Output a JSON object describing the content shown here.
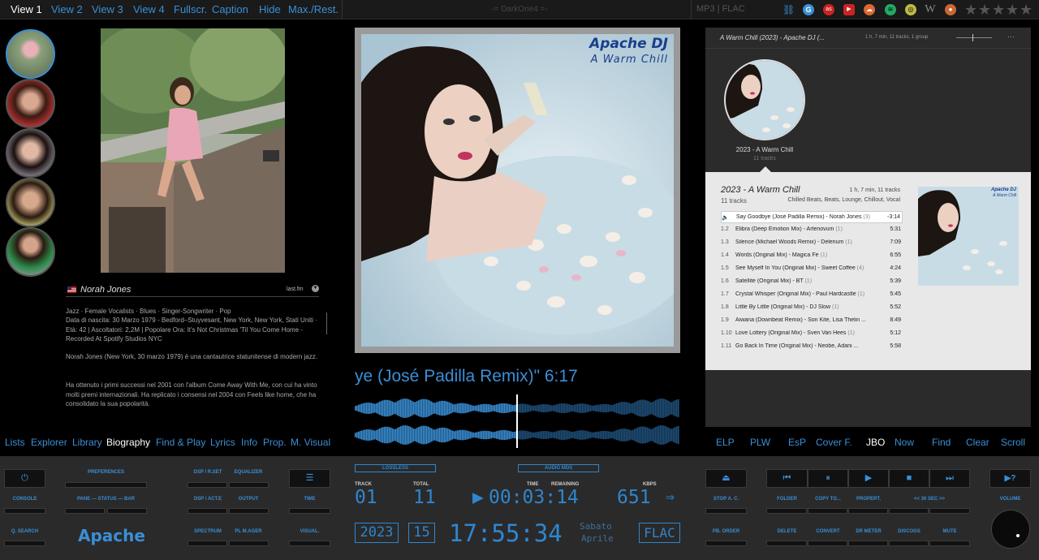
{
  "top_tabs": [
    "View 1",
    "View 2",
    "View 3",
    "View 4",
    "Fullscr.",
    "Caption",
    "Hide",
    "Max./Rest."
  ],
  "app_title": "-= DarkOne4 =-",
  "format_label": "MP3 | FLAC",
  "colors": {
    "accent": "#3a8fd6",
    "lcd": "#2f86cf",
    "list_bg": "#e8e8e8"
  },
  "web_icons": [
    "link-icon",
    "google-icon",
    "lastfm-icon",
    "youtube-icon",
    "soundcloud-icon",
    "spotify-icon",
    "discogs-icon",
    "wikipedia-icon",
    "musicbrainz-icon"
  ],
  "rating": {
    "stars": 5,
    "value": 0
  },
  "artist": {
    "name": "Norah Jones",
    "source": "last.fm",
    "tags": "Jazz · Female Vocalists · Blues · Singer-Songwriter · Pop",
    "info": "Data di nascita: 30 Marzo 1979 - Bedford–Stuyvesant, New York, New York, Stati Uniti · Età: 42  |  Ascoltatori: 2,2M  |  Popolare Ora: It's Not Christmas 'Til You Come Home - Recorded At Spotify Studios NYC",
    "bio1": "Norah Jones (New York, 30 marzo 1979) è una cantautrice statunitense di modern jazz.",
    "bio2": "Ha ottenuto i primi successi nel 2001 con l'album Come Away With Me, con cui ha vinto molti premi internazionali. Ha replicato i consensi nel 2004 con Feels like home, che ha consolidato la sua popolarità."
  },
  "cover": {
    "line1": "Apache DJ",
    "line2": "A Warm Chill"
  },
  "now_playing_scroll": "ye (José Padilla Remix)\" 6:17",
  "progress": 0.5,
  "album_panel": {
    "header_title": "A Warm Chill (2023) - Apache DJ (...",
    "header_meta": "1 h, 7 min,   11 tracks,   1 group",
    "year_album": "2023 - A Warm Chill",
    "tracks_short": "11 tracks",
    "album_title": "2023 - A Warm Chill",
    "duration": "1 h, 7 min,  11 tracks",
    "track_count": "11 tracks",
    "genres": "Chilled Beats, Beats, Lounge, Chillout, Vocal",
    "art_line1": "Apache DJ",
    "art_line2": "A Warm Chill"
  },
  "tracks": [
    {
      "num": "🔈",
      "title": "Say Goodbye (José Padilla Remix) - Norah Jones",
      "count": "(3)",
      "dur": "-3:14",
      "playing": true
    },
    {
      "num": "1.2",
      "title": "Elibra (Deep Emotion Mix) - Artenovum",
      "count": "(1)",
      "dur": "5:31"
    },
    {
      "num": "1.3",
      "title": "Silence (Michael Woods Remix) - Delerium",
      "count": "(1)",
      "dur": "7:09"
    },
    {
      "num": "1.4",
      "title": "Words (Original Mix) - Magica Fe",
      "count": "(1)",
      "dur": "6:55"
    },
    {
      "num": "1.5",
      "title": "See Myself In You (Original Mix) - Sweet Coffee",
      "count": "(4)",
      "dur": "4:24"
    },
    {
      "num": "1.6",
      "title": "Satellite (Original Mix) - BT",
      "count": "(1)",
      "dur": "5:39"
    },
    {
      "num": "1.7",
      "title": "Crystal Whisper (Original Mix) - Paul Hardcastle",
      "count": "(1)",
      "dur": "5:45"
    },
    {
      "num": "1.8",
      "title": "Little By Little (Original Mix) - DJ Slow",
      "count": "(1)",
      "dur": "5:52"
    },
    {
      "num": "1.9",
      "title": "Aiwana (Downbeat Remix) - Son Kite, Lisa Thelin ...",
      "count": "",
      "dur": "8:49"
    },
    {
      "num": "1.10",
      "title": "Love Lottery (Original Mix) - Sven Van Hees",
      "count": "(1)",
      "dur": "5:12"
    },
    {
      "num": "1.11",
      "title": "Go Back In Time (Original Mix) - Neobe, Adani ...",
      "count": "",
      "dur": "5:58"
    }
  ],
  "left_nav": [
    "Lists",
    "Explorer",
    "Library",
    "Biography",
    "Find & Play",
    "Lyrics",
    "Info",
    "Prop.",
    "M. Visual"
  ],
  "left_nav_active": "Biography",
  "right_nav": [
    "ELP",
    "PLW",
    "EsP",
    "Cover F.",
    "JBO",
    "Now",
    "Find",
    "Clear",
    "Scroll"
  ],
  "right_nav_active": "JBO",
  "controls": {
    "console": "CONSOLE",
    "search": "Q. SEARCH",
    "preferences": "PREFERENCES",
    "pane_status_bar": "PANE — STATUS — BAR",
    "brand": "Apache",
    "dsp_rset": "DSP / R.SET",
    "equalizer": "EQUALIZER",
    "dsp_acte": "DSP / ACT.E",
    "output": "OUTPUT",
    "spectrum": "SPECTRUM",
    "pl_mager": "PL M.AGER",
    "time": "TIME",
    "visual": "VISUAL.",
    "stop_ac": "STOP A. C.",
    "pb_order": "PB. ORDER",
    "folder": "FOLDER",
    "copy_to": "COPY TO...",
    "propert": "PROPERT.",
    "seek": "<<   30 SEC   >>",
    "delete": "DELETE",
    "convert": "CONVERT",
    "dr_meter": "DR METER",
    "discogs": "DISCOGS",
    "mute": "MUTE",
    "volume": "VOLUME"
  },
  "info_display": {
    "lossless": "LOSSLESS",
    "audio_mds": "AUDIO MDS",
    "track_label": "TRACK",
    "track": "01",
    "total_label": "TOTAL",
    "total": "11",
    "time_label": "TIME",
    "remaining_label": "REMAINING",
    "time": "00:03:14",
    "kbps_label": "KBPS",
    "kbps": "651",
    "year": "2023",
    "day": "15",
    "clock": "17:55:34",
    "weekday": "Sabato",
    "month": "Aprile",
    "codec": "FLAC"
  }
}
